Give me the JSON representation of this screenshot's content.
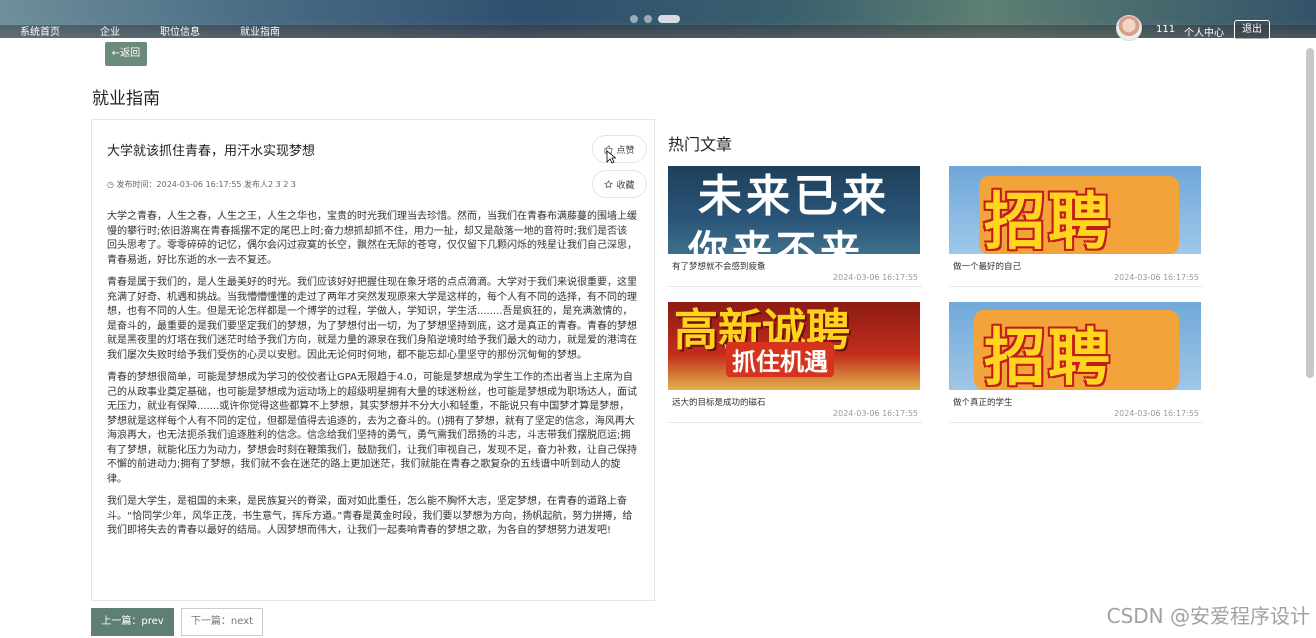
{
  "nav": {
    "items": [
      "系统首页",
      "企业",
      "职位信息",
      "就业指南"
    ]
  },
  "user": {
    "name": "111",
    "center_label": "个人中心",
    "logout_label": "退出"
  },
  "back_label": "←返回",
  "page_title": "就业指南",
  "article": {
    "title": "大学就该抓住青春，用汗水实现梦想",
    "like_label": "点赞",
    "favorite_label": "收藏",
    "meta": "发布时间：2024-03-06 16:17:55 发布人2 3 2 3",
    "paragraphs": [
      "大学之青春，人生之春，人生之王，人生之华也，宝贵的时光我们理当去珍惜。然而，当我们在青春布满藤蔓的围墙上缓慢的攀行时;依旧游离在青春摇摆不定的尾巴上时;奋力想抓却抓不住，用力一扯，却又是敲落一地的音符时;我们是否该回头思考了。零零碎碎的记忆，偶尔会闪过寂寞的长空，飘然在无际的苍穹，仅仅留下几颗闪烁的残星让我们自己深思，青春易逝，好比东逝的水一去不复还。",
      "青春是属于我们的，是人生最美好的时光。我们应该好好把握住现在象牙塔的点点滴滴。大学对于我们来说很重要，这里充满了好奇、机遇和挑战。当我懵懵懂懂的走过了两年才突然发现原来大学是这样的，每个人有不同的选择，有不同的理想，也有不同的人生。但是无论怎样都是一个博学的过程，学做人，学知识，学生活........吾是疯狂的，是充满激情的，是奋斗的，最重要的是我们要坚定我们的梦想，为了梦想付出一切，为了梦想坚持到底，这才是真正的青春。青春的梦想就是黑夜里的灯塔在我们迷茫时给予我们方向，就是力量的源泉在我们身陷逆境时给予我们最大的动力，就是爱的港湾在我们屡次失败时给予我们受伤的心灵以安慰。因此无论何时何地，都不能忘却心里坚守的那份沉甸甸的梦想。",
      "青春的梦想很简单，可能是梦想成为学习的佼佼者让GPA无限趋于4.0，可能是梦想成为学生工作的杰出者当上主席为自己的从政事业奠定基础，也可能是梦想成为运动场上的超级明星拥有大量的球迷粉丝，也可能是梦想成为职场达人，面试无压力，就业有保障.......或许你觉得这些都算不上梦想，其实梦想并不分大小和轻重，不能说只有中国梦才算是梦想，梦想就是这样每个人有不同的定位，但都是值得去追逐的，去为之奋斗的。()拥有了梦想，就有了坚定的信念，海风再大海浪再大，也无法扼杀我们追逐胜利的信念。信念给我们坚持的勇气，勇气需我们昂扬的斗志，斗志带我们摆脱厄运;拥有了梦想，就能化压力为动力，梦想会时刻在鞭策我们，鼓励我们，让我们审视自己，发现不足，奋力补救，让自己保持不懈的前进动力;拥有了梦想，我们就不会在迷茫的路上更加迷茫，我们就能在青春之歌复杂的五线谱中听到动人的旋律。",
      "我们是大学生，是祖国的未来，是民族复兴的脊梁，面对如此重任，怎么能不胸怀大志，坚定梦想，在青春的道路上奋斗。“恰同学少年，风华正茂，书生意气，挥斥方遒。”青春是黄金时段，我们要以梦想为方向，扬帆起航，努力拼搏，给我们即将失去的青春以最好的结局。人因梦想而伟大，让我们一起奏响青春的梦想之歌，为各自的梦想努力进发吧!"
    ]
  },
  "prev_label": "上一篇：prev",
  "next_label": "下一篇：next",
  "hot": {
    "title": "热门文章",
    "cards": [
      {
        "image_text_1": "未来已来",
        "image_text_2": "你来不来",
        "caption": "有了梦想就不会感到疲惫",
        "date": "2024-03-06 16:17:55"
      },
      {
        "image_text_1": "招聘",
        "caption": "做一个最好的自己",
        "date": "2024-03-06 16:17:55"
      },
      {
        "image_text_1": "高新诚聘",
        "image_text_2": "抓住机遇",
        "caption": "远大的目标是成功的磁石",
        "date": "2024-03-06 16:17:55"
      },
      {
        "image_text_1": "招聘",
        "caption": "做个真正的学生",
        "date": "2024-03-06 16:17:55"
      }
    ]
  },
  "watermark": "CSDN @安爱程序设计"
}
